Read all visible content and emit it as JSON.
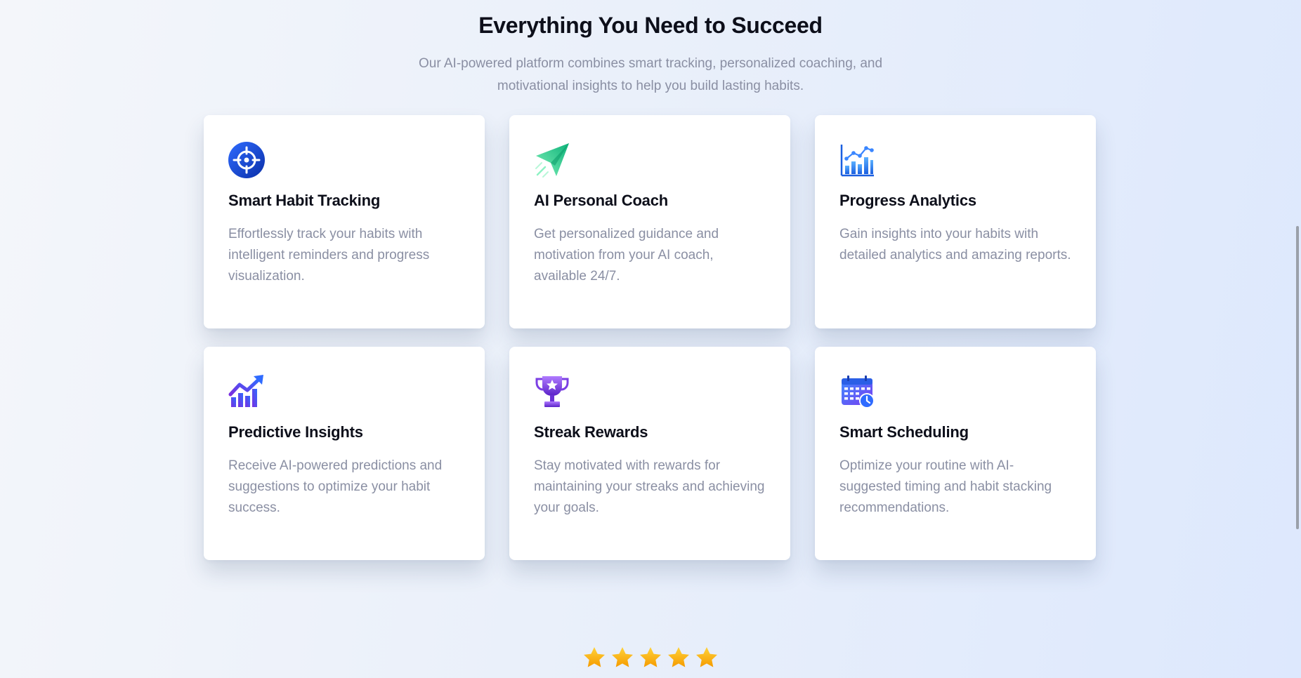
{
  "section": {
    "title": "Everything You Need to Succeed",
    "subtitle": "Our AI-powered platform combines smart tracking, personalized coaching, and motivational insights to help you build lasting habits."
  },
  "features": [
    {
      "icon": "crosshair-target-icon",
      "title": "Smart Habit Tracking",
      "description": "Effortlessly track your habits with intelligent reminders and progress visualization."
    },
    {
      "icon": "paper-plane-icon",
      "title": "AI Personal Coach",
      "description": "Get personalized guidance and motivation from your AI coach, available 24/7."
    },
    {
      "icon": "analytics-chart-icon",
      "title": "Progress Analytics",
      "description": "Gain insights into your habits with detailed analytics and amazing reports."
    },
    {
      "icon": "trending-up-chart-icon",
      "title": "Predictive Insights",
      "description": "Receive AI-powered predictions and suggestions to optimize your habit success."
    },
    {
      "icon": "trophy-icon",
      "title": "Streak Rewards",
      "description": "Stay motivated with rewards for maintaining your streaks and achieving your goals."
    },
    {
      "icon": "calendar-clock-icon",
      "title": "Smart Scheduling",
      "description": "Optimize your routine with AI-suggested timing and habit stacking recommendations."
    }
  ],
  "rating": {
    "stars": 5,
    "star_color": "#f7b500"
  },
  "colors": {
    "heading": "#0d0f1a",
    "muted_text": "#8a8fa3",
    "card_background": "#ffffff",
    "accent_blue": "#1a4fd6",
    "accent_green": "#1fc98a",
    "accent_purple": "#7b3fe4"
  }
}
